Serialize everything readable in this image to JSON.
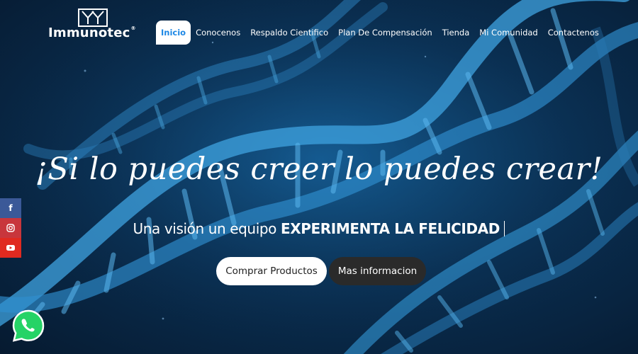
{
  "brand": {
    "name": "Immunotec",
    "reg_mark": "®"
  },
  "nav": {
    "items": [
      {
        "label": "Inicio",
        "active": true
      },
      {
        "label": "Conocenos",
        "active": false
      },
      {
        "label": "Respaldo Cientifico",
        "active": false
      },
      {
        "label": "Plan De Compensación",
        "active": false
      },
      {
        "label": "Tienda",
        "active": false
      },
      {
        "label": "Mi Comunidad",
        "active": false
      },
      {
        "label": "Contactenos",
        "active": false
      }
    ]
  },
  "hero": {
    "tagline": "¡Si lo puedes creer lo puedes crear!",
    "subline_regular": "Una visión un equipo",
    "subline_bold": "EXPERIMENTA LA FELICIDAD"
  },
  "buttons": {
    "primary_label": "Comprar Productos",
    "secondary_label": "Mas informacion"
  },
  "social": {
    "facebook_glyph": "f",
    "instagram_icon": "instagram-icon",
    "youtube_icon": "youtube-icon",
    "whatsapp_icon": "whatsapp-icon"
  },
  "colors": {
    "active_nav_text": "#1e88e5",
    "facebook": "#3b5998",
    "instagram": "#c8363c",
    "youtube": "#e02a20",
    "whatsapp": "#25d366",
    "secondary_button": "#2a2a2a"
  }
}
